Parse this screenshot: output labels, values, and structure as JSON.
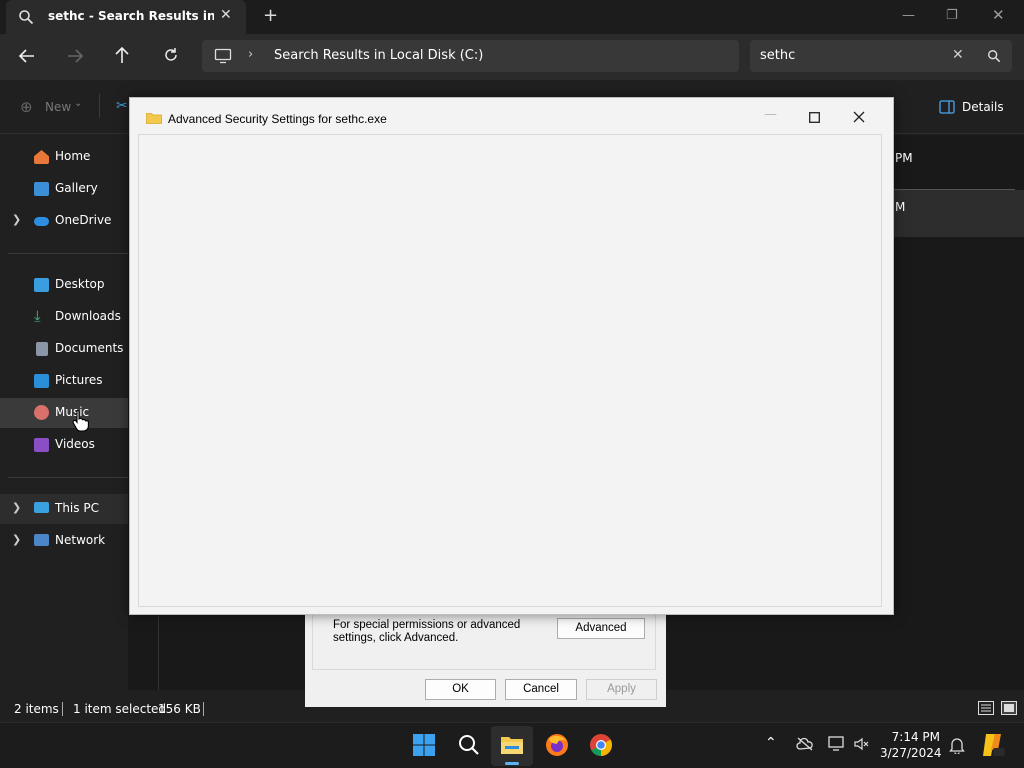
{
  "explorer": {
    "tab_title": "sethc - Search Results in System",
    "address_path": "Search Results in Local Disk (C:)",
    "search_value": "sethc",
    "new_label": "New",
    "details_label": "Details",
    "partial_times": [
      "PM",
      "M"
    ]
  },
  "sidebar": {
    "items": [
      {
        "label": "Home"
      },
      {
        "label": "Gallery"
      },
      {
        "label": "OneDrive"
      },
      {
        "label": "Desktop"
      },
      {
        "label": "Downloads"
      },
      {
        "label": "Documents"
      },
      {
        "label": "Pictures"
      },
      {
        "label": "Music"
      },
      {
        "label": "Videos"
      },
      {
        "label": "This PC"
      },
      {
        "label": "Network"
      }
    ]
  },
  "status": {
    "items_count": "2 items",
    "selection": "1 item selected",
    "size": "156 KB"
  },
  "properties_dialog": {
    "advanced_text": "For special permissions or advanced settings, click Advanced.",
    "advanced_button": "Advanced",
    "ok_button": "OK",
    "cancel_button": "Cancel",
    "apply_button": "Apply"
  },
  "advanced_dialog": {
    "title": "Advanced Security Settings for sethc.exe"
  },
  "taskbar": {
    "time": "7:14 PM",
    "date": "3/27/2024"
  },
  "colors": {
    "accent": "#0078d4",
    "dark_bg": "#202020",
    "dialog_bg": "#f3f3f3"
  }
}
